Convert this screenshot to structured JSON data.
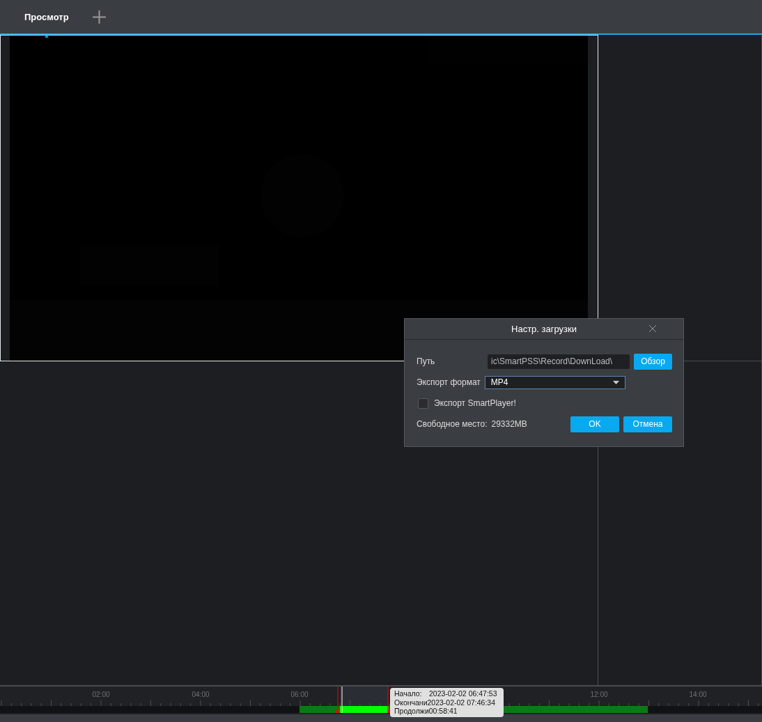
{
  "tabs": [
    {
      "label": "Просмотр",
      "selected": true
    }
  ],
  "dialog": {
    "title": "Настр. загрузки",
    "path": {
      "label": "Путь",
      "value": "ic\\SmartPSS\\Record\\DownLoad\\",
      "button": "Обзор"
    },
    "format": {
      "label": "Экспорт формат",
      "value": "MP4"
    },
    "smartplayer": {
      "label": "Экспорт SmartPlayer!",
      "checked": false
    },
    "free_space": {
      "label": "Свободное место:",
      "value": "29332MB"
    },
    "buttons": [
      "OK",
      "Отмена"
    ]
  },
  "timeline": {
    "ticks": [
      "02:00",
      "04:00",
      "06:00",
      "12:00",
      "14:00"
    ],
    "tooltip": [
      {
        "label": "Начало:",
        "value": "2023-02-02 06:47:53"
      },
      {
        "label": "Окончани",
        "value": "2023-02-02 07:46:34"
      },
      {
        "label": "Продолжи",
        "value": "00:58:41"
      }
    ]
  }
}
